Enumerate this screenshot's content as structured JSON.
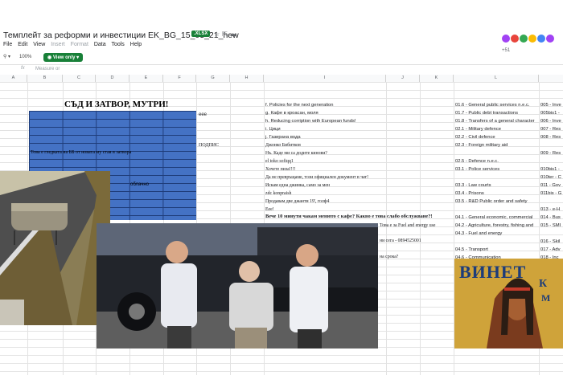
{
  "header": {
    "doc_title": "Темплейт за реформи и инвестиции EK_BG_15_03_21_new",
    "file_badge": ".XLSX",
    "menu": [
      "File",
      "Edit",
      "View",
      "Insert",
      "Format",
      "Data",
      "Tools",
      "Help"
    ],
    "avatar_count": "+51",
    "avatar_colors": [
      "#a142f4",
      "#e8453c",
      "#34a853",
      "#fbbc04",
      "#4285f4",
      "#a142f4"
    ]
  },
  "toolbar": {
    "zoom": "100%",
    "view_only": "View only"
  },
  "formula_bar": {
    "fx": "fx",
    "text": "Measure or"
  },
  "columns": [
    "A",
    "B",
    "C",
    "D",
    "E",
    "F",
    "G",
    "H",
    "I",
    "J",
    "K",
    "L"
  ],
  "sheet": {
    "heading": "СЪД И ЗАТВОР, МУТРИ!",
    "g_cell": "еее",
    "podpis": "ПОДПИС",
    "overlay_text": "Това е гледката на ББ от новата му стая в затвора",
    "oblachno": "облачно"
  },
  "col_i": [
    "f. Policies for the next generation",
    "g. Кафе в кроасан, моля",
    "h. Reducing corription with European funds!",
    "i. Цици",
    "j. Газирана вода",
    "Джонко Бибитков",
    "Нъ. Каде ми са додите кинови?",
    "el toko sofiqq1",
    "Хочете пиза!!!!",
    "Да не превръщаме, този официален документ в чат!",
    "Искам една джинка, само за мен",
    "zdc konpraish",
    "Продавам две джанти 19', голф4",
    "Eee!",
    "Вече 10 минути чакам менюто с кафе? Какво е това слабо обслужване?!",
    "Това е за Fuel and energy use",
    "ни сега - 0894525001",
    "на срока?"
  ],
  "col_l": [
    "01.6 - General public services n.e.c.",
    "01.7 - Public debt transactions",
    "01.8 - Transfers of a general character",
    "02.1 - Military defence",
    "02.2 - Civil defence",
    "02.3 - Foreign military aid",
    "",
    "02.5 - Defence n.e.c.",
    "03.1 - Police services",
    "",
    "03.3 - Law courts",
    "03.4 - Prisons",
    "03.5 - R&D Public order and safety",
    "",
    "04.1 - General economic, commercial",
    "04.2 - Agriculture, forestry, fishing and",
    "04.3 - Fuel and energy",
    "",
    "04.5 - Transport",
    "04.6 - Communication"
  ],
  "col_m": [
    "005 - Inve",
    "005bis1 -",
    "006 - Inve",
    "007 - Res",
    "008 - Res",
    "",
    "009 - Res",
    "",
    "010bis1 -",
    "010ter - C",
    "011 - Gov",
    "011bis - G",
    "",
    "013 - e-H",
    "014 - Bus",
    "015 - SMI",
    "",
    "016 - Skil",
    "017 - Adv",
    "018 - Inc"
  ],
  "poster_text": [
    "ВИНЕТ",
    "К",
    "М"
  ]
}
